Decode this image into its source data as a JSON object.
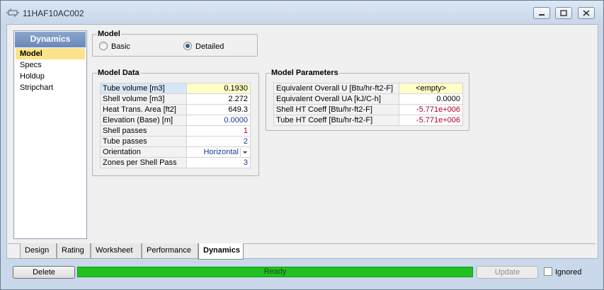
{
  "window": {
    "title": "11HAF10AC002"
  },
  "sidebar": {
    "header": "Dynamics",
    "items": [
      {
        "label": "Model",
        "active": true
      },
      {
        "label": "Specs"
      },
      {
        "label": "Holdup"
      },
      {
        "label": "Stripchart"
      }
    ]
  },
  "model": {
    "title": "Model",
    "options": [
      {
        "label": "Basic",
        "selected": false
      },
      {
        "label": "Detailed",
        "selected": true
      }
    ]
  },
  "model_data": {
    "title": "Model Data",
    "rows": [
      {
        "label": "Tube volume [m3]",
        "value": "0.1930",
        "style": "hl"
      },
      {
        "label": "Shell volume [m3]",
        "value": "2.272",
        "style": ""
      },
      {
        "label": "Heat Trans. Area [ft2]",
        "value": "649.3",
        "style": ""
      },
      {
        "label": "Elevation (Base) [m]",
        "value": "0.0000",
        "style": "blue"
      },
      {
        "label": "Shell passes",
        "value": "1",
        "style": "red"
      },
      {
        "label": "Tube passes",
        "value": "2",
        "style": "blue"
      },
      {
        "label": "Orientation",
        "value": "Horizontal",
        "style": "blue"
      },
      {
        "label": "Zones per Shell Pass",
        "value": "3",
        "style": "blue"
      }
    ]
  },
  "model_parameters": {
    "title": "Model Parameters",
    "rows": [
      {
        "label": "Equivalent Overall U [Btu/hr-ft2-F]",
        "value": "<empty>",
        "style": "empty"
      },
      {
        "label": "Equivalent Overall UA [kJ/C-h]",
        "value": "0.0000",
        "style": ""
      },
      {
        "label": "Shell HT Coeff [Btu/hr-ft2-F]",
        "value": "-5.771e+006",
        "style": "red"
      },
      {
        "label": "Tube HT Coeff [Btu/hr-ft2-F]",
        "value": "-5.771e+006",
        "style": "red"
      }
    ]
  },
  "tabs": [
    {
      "label": "Design"
    },
    {
      "label": "Rating"
    },
    {
      "label": "Worksheet"
    },
    {
      "label": "Performance"
    },
    {
      "label": "Dynamics",
      "active": true
    }
  ],
  "bottom": {
    "delete_label": "Delete",
    "status_text": "Ready",
    "update_label": "Update",
    "ignored_label": "Ignored",
    "ignored_checked": false
  },
  "colors": {
    "status_green": "#21c11f",
    "highlight": "#fbe38a",
    "value_red": "#b0002b",
    "value_blue": "#1a3a9a"
  }
}
